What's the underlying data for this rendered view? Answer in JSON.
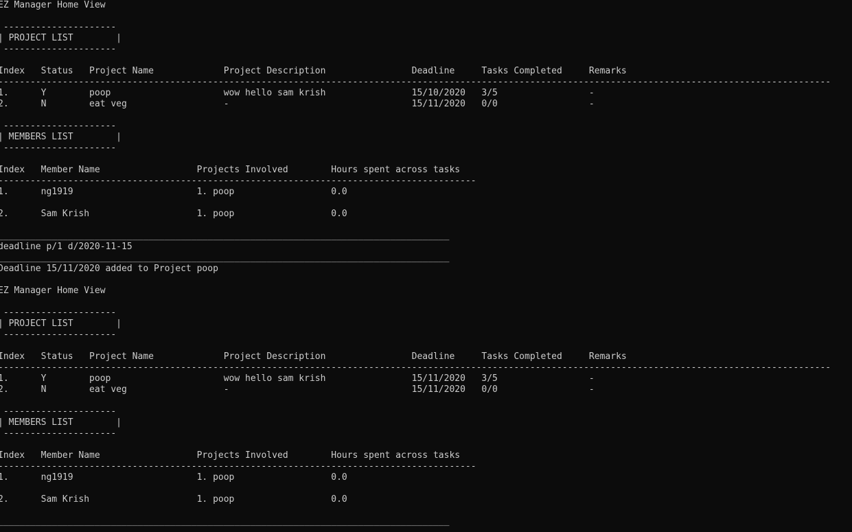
{
  "console": {
    "lines": [
      "EZ Manager Home View",
      "",
      " ---------------------",
      "| PROJECT LIST        |",
      " ---------------------",
      "",
      "Index   Status   Project Name             Project Description                Deadline     Tasks Completed     Remarks",
      "-----------------------------------------------------------------------------------------------------------------------------------------------------------",
      "1.      Y        poop                     wow hello sam krish                15/10/2020   3/5                 -",
      "2.      N        eat veg                  -                                  15/11/2020   0/0                 -",
      "",
      " ---------------------",
      "| MEMBERS LIST        |",
      " ---------------------",
      "",
      "Index   Member Name                  Projects Involved        Hours spent across tasks",
      "-----------------------------------------------------------------------------------------",
      "1.      ng1919                       1. poop                  0.0",
      "",
      "2.      Sam Krish                    1. poop                  0.0",
      "",
      "____________________________________________________________________________________",
      "deadline p/1 d/2020-11-15",
      "____________________________________________________________________________________",
      "Deadline 15/11/2020 added to Project poop",
      "",
      "EZ Manager Home View",
      "",
      " ---------------------",
      "| PROJECT LIST        |",
      " ---------------------",
      "",
      "Index   Status   Project Name             Project Description                Deadline     Tasks Completed     Remarks",
      "-----------------------------------------------------------------------------------------------------------------------------------------------------------",
      "1.      Y        poop                     wow hello sam krish                15/11/2020   3/5                 -",
      "2.      N        eat veg                  -                                  15/11/2020   0/0                 -",
      "",
      " ---------------------",
      "| MEMBERS LIST        |",
      " ---------------------",
      "",
      "Index   Member Name                  Projects Involved        Hours spent across tasks",
      "-----------------------------------------------------------------------------------------",
      "1.      ng1919                       1. poop                  0.0",
      "",
      "2.      Sam Krish                    1. poop                  0.0",
      "",
      "____________________________________________________________________________________"
    ]
  }
}
